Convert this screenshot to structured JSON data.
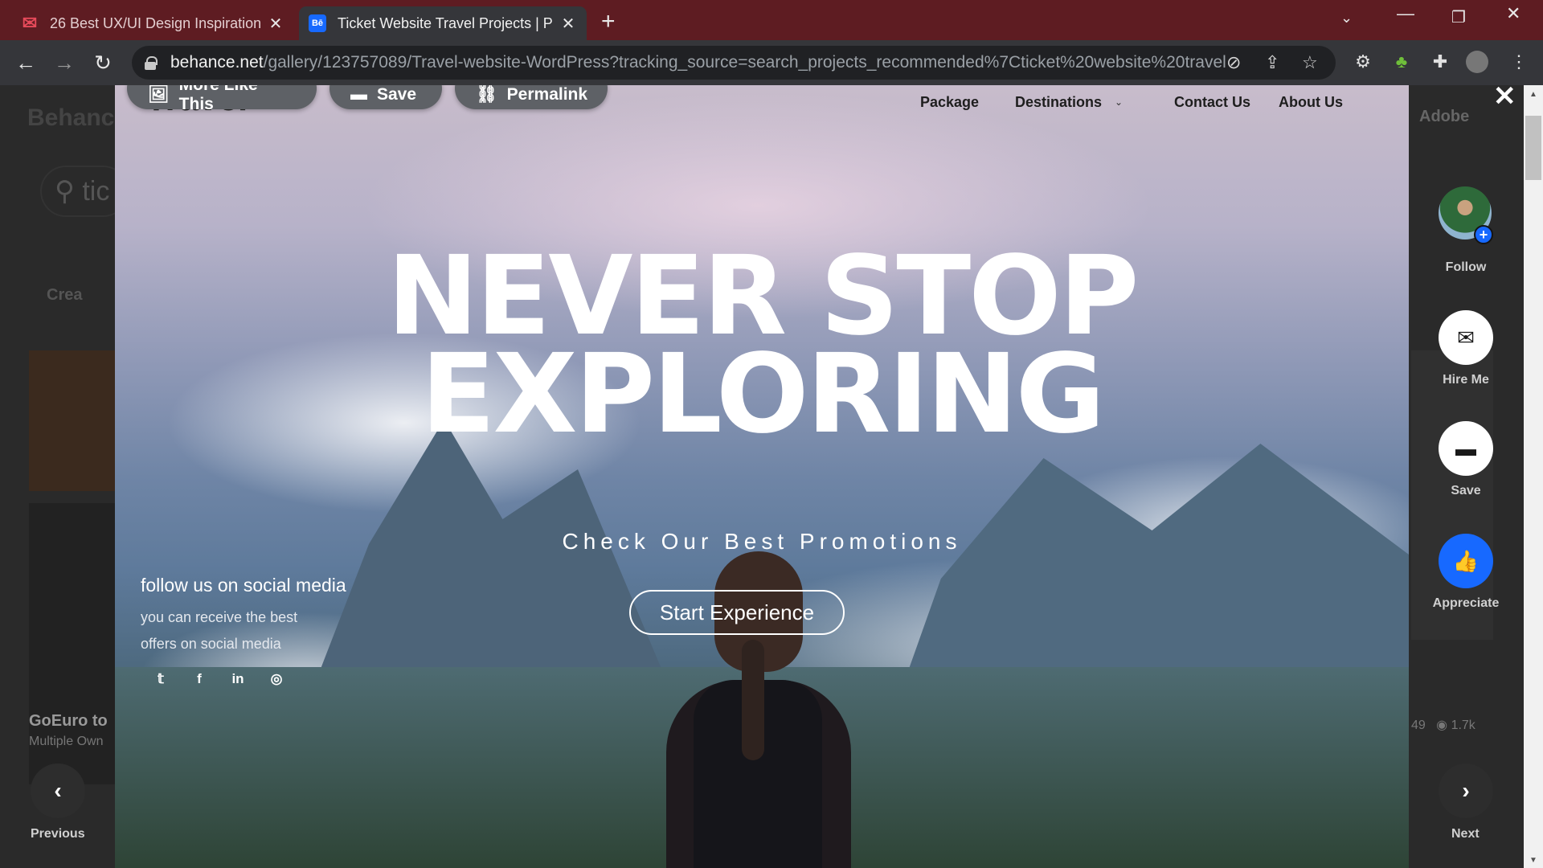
{
  "browser": {
    "tabs": [
      {
        "title": "26 Best UX/UI Design Inspiration",
        "favicon": "gmail-icon",
        "active": false
      },
      {
        "title": "Ticket Website Travel Projects | Ph",
        "favicon": "behance-icon",
        "active": true
      }
    ],
    "url_host": "behance.net",
    "url_path": "/gallery/123757089/Travel-website-WordPress?tracking_source=search_projects_recommended%7Cticket%20website%20travel"
  },
  "background": {
    "logo": "Behance",
    "search_text": "tic",
    "filter": "Crea",
    "card_title": "GoEuro to",
    "card_subtitle": "Multiple Own",
    "adobe": "Adobe",
    "stats_count": "49",
    "stats_views": "1.7k"
  },
  "modal_toolbar": {
    "more_like_this": "More Like This",
    "save": "Save",
    "permalink": "Permalink"
  },
  "site": {
    "logo": "Travel",
    "nav": [
      "Package",
      "Destinations",
      "Contact Us",
      "About Us"
    ],
    "hero_line1": "NEVER STOP",
    "hero_line2": "EXPLORING",
    "hero_sub": "Check Our Best Promotions",
    "cta": "Start Experience",
    "social_title": "follow us on social media",
    "social_desc": "you can receive the best offers on social media",
    "social_icons": [
      "twitter-icon",
      "facebook-icon",
      "linkedin-icon",
      "instagram-icon"
    ]
  },
  "actions": {
    "follow": "Follow",
    "hire_me": "Hire Me",
    "save": "Save",
    "appreciate": "Appreciate"
  },
  "pager": {
    "previous": "Previous",
    "next": "Next"
  },
  "colors": {
    "tabbar": "#5e1c22",
    "behance_blue": "#1769ff"
  }
}
